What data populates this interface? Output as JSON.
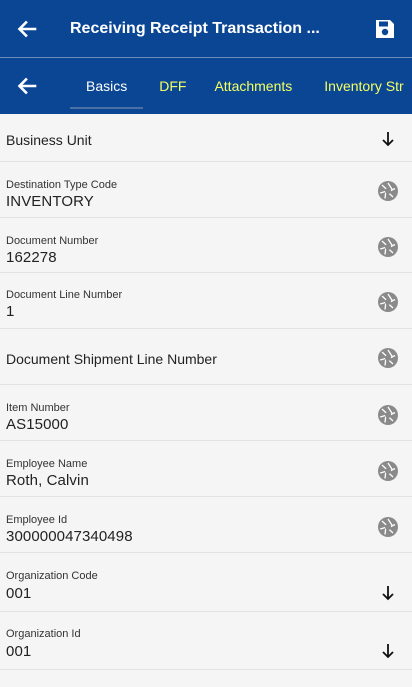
{
  "header": {
    "title": "Receiving Receipt Transaction ...",
    "back_icon": "arrow-left-icon",
    "save_icon": "save-icon"
  },
  "tabs": [
    {
      "label": "Basics",
      "selected": true
    },
    {
      "label": "DFF"
    },
    {
      "label": "Attachments"
    },
    {
      "label": "Inventory Str"
    }
  ],
  "colors": {
    "header_bg": "#0b4694",
    "tab_inactive": "#f4ff63",
    "tab_active": "#ffffff"
  },
  "fields": [
    {
      "label": "Business Unit",
      "value": "",
      "action_icon": "arrow-down-icon"
    },
    {
      "label": "Destination Type Code",
      "value": "INVENTORY",
      "action_icon": "camera-shutter-icon"
    },
    {
      "label": "Document Number",
      "value": "162278",
      "action_icon": "camera-shutter-icon"
    },
    {
      "label": "Document Line Number",
      "value": "1",
      "action_icon": "camera-shutter-icon"
    },
    {
      "label": "Document Shipment Line Number",
      "value": "",
      "action_icon": "camera-shutter-icon"
    },
    {
      "label": "Item Number",
      "value": "AS15000",
      "action_icon": "camera-shutter-icon"
    },
    {
      "label": "Employee Name",
      "value": "Roth, Calvin",
      "action_icon": "camera-shutter-icon"
    },
    {
      "label": "Employee Id",
      "value": "300000047340498",
      "action_icon": "camera-shutter-icon"
    },
    {
      "label": "Organization Code",
      "value": "001",
      "action_icon": "arrow-down-icon"
    },
    {
      "label": "Organization Id",
      "value": "001",
      "action_icon": "arrow-down-icon"
    }
  ]
}
